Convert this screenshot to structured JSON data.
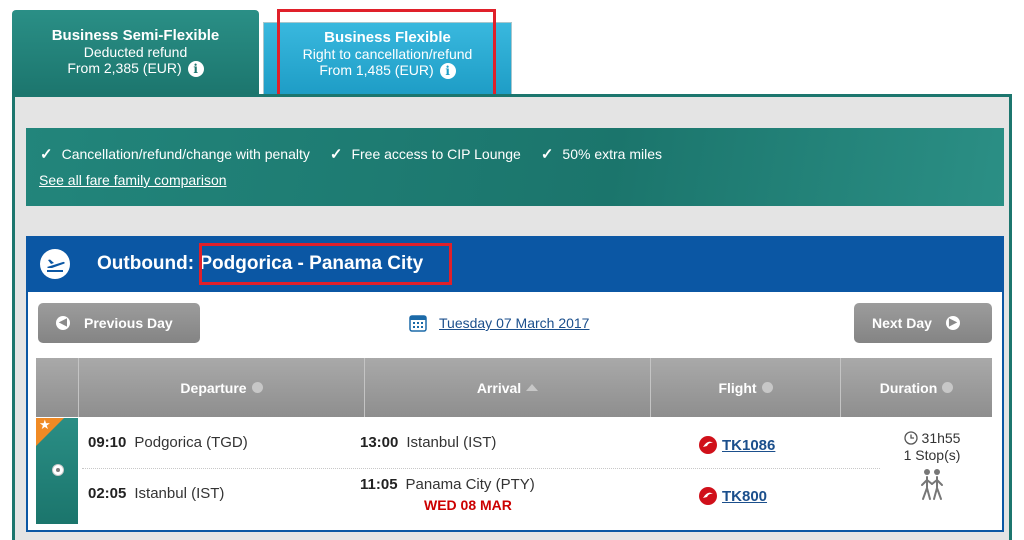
{
  "fare_tabs": [
    {
      "title": "Business Semi-Flexible",
      "subtitle": "Deducted refund",
      "price": "From 2,385 (EUR)"
    },
    {
      "title": "Business Flexible",
      "subtitle": "Right to cancellation/refund",
      "price": "From 1,485 (EUR)"
    }
  ],
  "features": {
    "items": [
      "Cancellation/refund/change with penalty",
      "Free access to CIP Lounge",
      "50% extra miles"
    ],
    "link": "See all fare family comparison"
  },
  "outbound": {
    "label": "Outbound:",
    "route": "Podgorica - Panama City"
  },
  "date_nav": {
    "prev_label": "Previous Day",
    "next_label": "Next Day",
    "date": "Tuesday 07 March 2017"
  },
  "table": {
    "headers": [
      "Departure",
      "Arrival",
      "Flight",
      "Duration"
    ],
    "row": {
      "segments": [
        {
          "dep_time": "09:10",
          "dep_place": "Podgorica (TGD)",
          "arr_time": "13:00",
          "arr_place": "Istanbul (IST)",
          "flight": "TK1086"
        },
        {
          "dep_time": "02:05",
          "dep_place": "Istanbul (IST)",
          "arr_time": "11:05",
          "arr_place": "Panama City (PTY)",
          "arr_note": "WED 08 MAR",
          "flight": "TK800"
        }
      ],
      "duration": "31h55",
      "stops": "1 Stop(s)"
    }
  },
  "colors": {
    "teal": "#1c766e",
    "blue": "#0b57a4",
    "highlight": "#e0202a",
    "red_text": "#cc0000"
  }
}
